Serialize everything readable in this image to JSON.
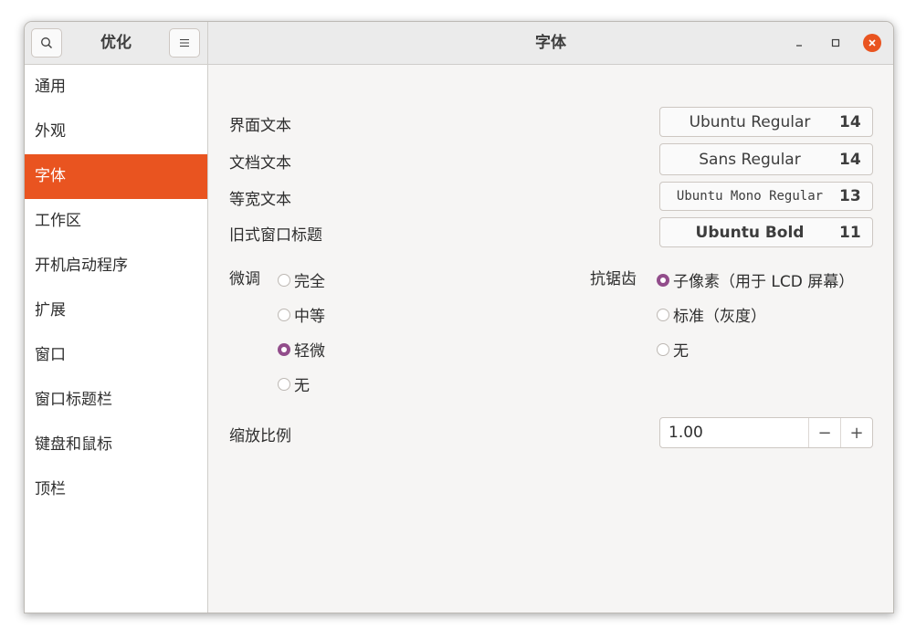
{
  "sidebar_header": {
    "title": "优化",
    "search_icon": "search-icon",
    "menu_icon": "hamburger-menu-icon"
  },
  "header": {
    "title": "字体",
    "controls": {
      "minimize_icon": "minimize-icon",
      "maximize_icon": "maximize-icon",
      "close_icon": "close-icon"
    }
  },
  "accent_color": "#e95420",
  "radio_color": "#924d8b",
  "sidebar": {
    "items": [
      {
        "label": "通用"
      },
      {
        "label": "外观"
      },
      {
        "label": "字体",
        "active": true
      },
      {
        "label": "工作区"
      },
      {
        "label": "开机启动程序"
      },
      {
        "label": "扩展"
      },
      {
        "label": "窗口"
      },
      {
        "label": "窗口标题栏"
      },
      {
        "label": "键盘和鼠标"
      },
      {
        "label": "顶栏"
      }
    ]
  },
  "fonts": [
    {
      "label": "界面文本",
      "font": "Ubuntu Regular",
      "size": "14"
    },
    {
      "label": "文档文本",
      "font": "Sans Regular",
      "size": "14"
    },
    {
      "label": "等宽文本",
      "font": "Ubuntu Mono Regular",
      "size": "13"
    },
    {
      "label": "旧式窗口标题",
      "font": "Ubuntu Bold",
      "size": "11"
    }
  ],
  "hinting": {
    "label": "微调",
    "options": [
      "完全",
      "中等",
      "轻微",
      "无"
    ],
    "selected": "轻微"
  },
  "antialiasing": {
    "label": "抗锯齿",
    "options": [
      "子像素（用于 LCD 屏幕）",
      "标准（灰度）",
      "无"
    ],
    "selected": "子像素（用于 LCD 屏幕）"
  },
  "scaling": {
    "label": "缩放比例",
    "value": "1.00",
    "minus": "−",
    "plus": "+"
  }
}
